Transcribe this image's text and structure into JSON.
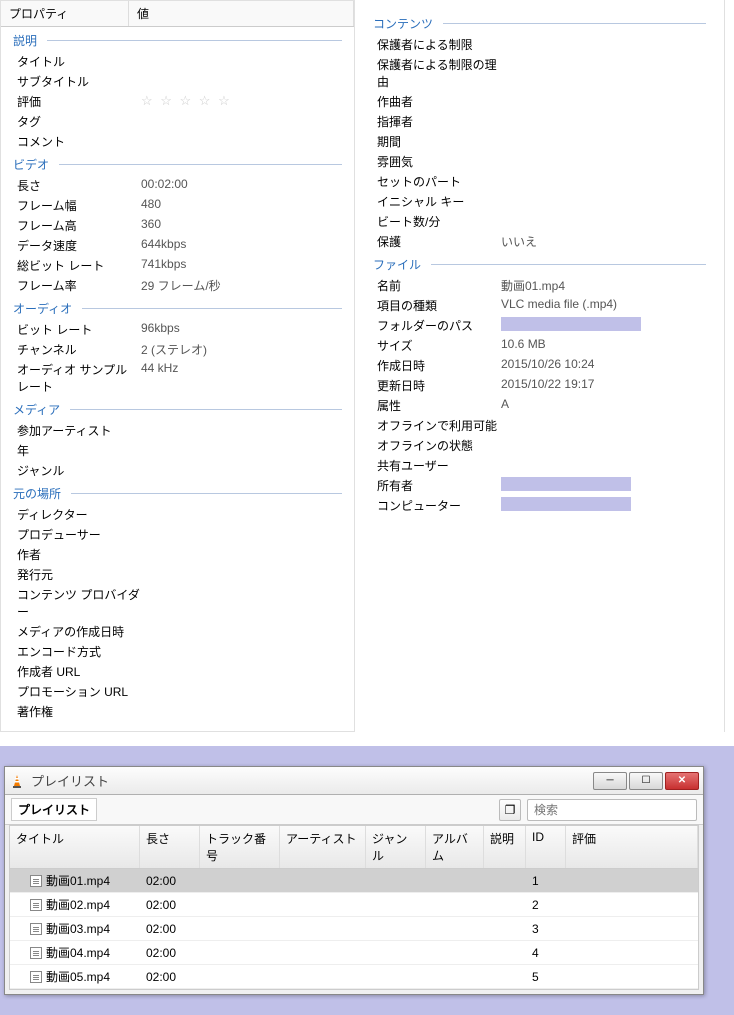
{
  "header": {
    "prop": "プロパティ",
    "val": "値"
  },
  "sections": {
    "desc": {
      "title": "説明",
      "rows": [
        {
          "label": "タイトル",
          "value": ""
        },
        {
          "label": "サブタイトル",
          "value": ""
        },
        {
          "label": "評価",
          "value": "stars"
        },
        {
          "label": "タグ",
          "value": ""
        },
        {
          "label": "コメント",
          "value": ""
        }
      ]
    },
    "video": {
      "title": "ビデオ",
      "rows": [
        {
          "label": "長さ",
          "value": "00:02:00"
        },
        {
          "label": "フレーム幅",
          "value": "480"
        },
        {
          "label": "フレーム高",
          "value": "360"
        },
        {
          "label": "データ速度",
          "value": "644kbps"
        },
        {
          "label": "総ビット レート",
          "value": "741kbps"
        },
        {
          "label": "フレーム率",
          "value": "29 フレーム/秒"
        }
      ]
    },
    "audio": {
      "title": "オーディオ",
      "rows": [
        {
          "label": "ビット レート",
          "value": "96kbps"
        },
        {
          "label": "チャンネル",
          "value": "2 (ステレオ)"
        },
        {
          "label": "オーディオ サンプル レート",
          "value": "44 kHz"
        }
      ]
    },
    "media": {
      "title": "メディア",
      "rows": [
        {
          "label": "参加アーティスト",
          "value": ""
        },
        {
          "label": "年",
          "value": ""
        },
        {
          "label": "ジャンル",
          "value": ""
        }
      ]
    },
    "origin": {
      "title": "元の場所",
      "rows": [
        {
          "label": "ディレクター",
          "value": ""
        },
        {
          "label": "プロデューサー",
          "value": ""
        },
        {
          "label": "作者",
          "value": ""
        },
        {
          "label": "発行元",
          "value": ""
        },
        {
          "label": "コンテンツ プロバイダー",
          "value": ""
        },
        {
          "label": "メディアの作成日時",
          "value": ""
        },
        {
          "label": "エンコード方式",
          "value": ""
        },
        {
          "label": "作成者 URL",
          "value": ""
        },
        {
          "label": "プロモーション URL",
          "value": ""
        },
        {
          "label": "著作権",
          "value": ""
        }
      ]
    },
    "content": {
      "title": "コンテンツ",
      "rows": [
        {
          "label": "保護者による制限",
          "value": ""
        },
        {
          "label": "保護者による制限の理由",
          "value": ""
        },
        {
          "label": "作曲者",
          "value": ""
        },
        {
          "label": "指揮者",
          "value": ""
        },
        {
          "label": "期間",
          "value": ""
        },
        {
          "label": "雰囲気",
          "value": ""
        },
        {
          "label": "セットのパート",
          "value": ""
        },
        {
          "label": "イニシャル キー",
          "value": ""
        },
        {
          "label": "ビート数/分",
          "value": ""
        },
        {
          "label": "保護",
          "value": "いいえ"
        }
      ]
    },
    "file": {
      "title": "ファイル",
      "rows": [
        {
          "label": "名前",
          "value": "動画01.mp4"
        },
        {
          "label": "項目の種類",
          "value": "VLC media file (.mp4)"
        },
        {
          "label": "フォルダーのパス",
          "value": "redact1"
        },
        {
          "label": "サイズ",
          "value": "10.6 MB"
        },
        {
          "label": "作成日時",
          "value": "2015/10/26 10:24"
        },
        {
          "label": "更新日時",
          "value": "2015/10/22 19:17"
        },
        {
          "label": "属性",
          "value": "A"
        },
        {
          "label": "オフラインで利用可能",
          "value": ""
        },
        {
          "label": "オフラインの状態",
          "value": ""
        },
        {
          "label": "共有ユーザー",
          "value": ""
        },
        {
          "label": "所有者",
          "value": "redact2"
        },
        {
          "label": "コンピューター",
          "value": "redact2"
        }
      ]
    }
  },
  "playlist": {
    "window_title": "プレイリスト",
    "toolbar_label": "プレイリスト",
    "search_placeholder": "検索",
    "columns": {
      "title": "タイトル",
      "length": "長さ",
      "track": "トラック番号",
      "artist": "アーティスト",
      "genre": "ジャンル",
      "album": "アルバム",
      "desc": "説明",
      "id": "ID",
      "rating": "評価"
    },
    "rows": [
      {
        "title": "動画01.mp4",
        "length": "02:00",
        "id": "1",
        "selected": true
      },
      {
        "title": "動画02.mp4",
        "length": "02:00",
        "id": "2",
        "selected": false
      },
      {
        "title": "動画03.mp4",
        "length": "02:00",
        "id": "3",
        "selected": false
      },
      {
        "title": "動画04.mp4",
        "length": "02:00",
        "id": "4",
        "selected": false
      },
      {
        "title": "動画05.mp4",
        "length": "02:00",
        "id": "5",
        "selected": false
      }
    ]
  }
}
